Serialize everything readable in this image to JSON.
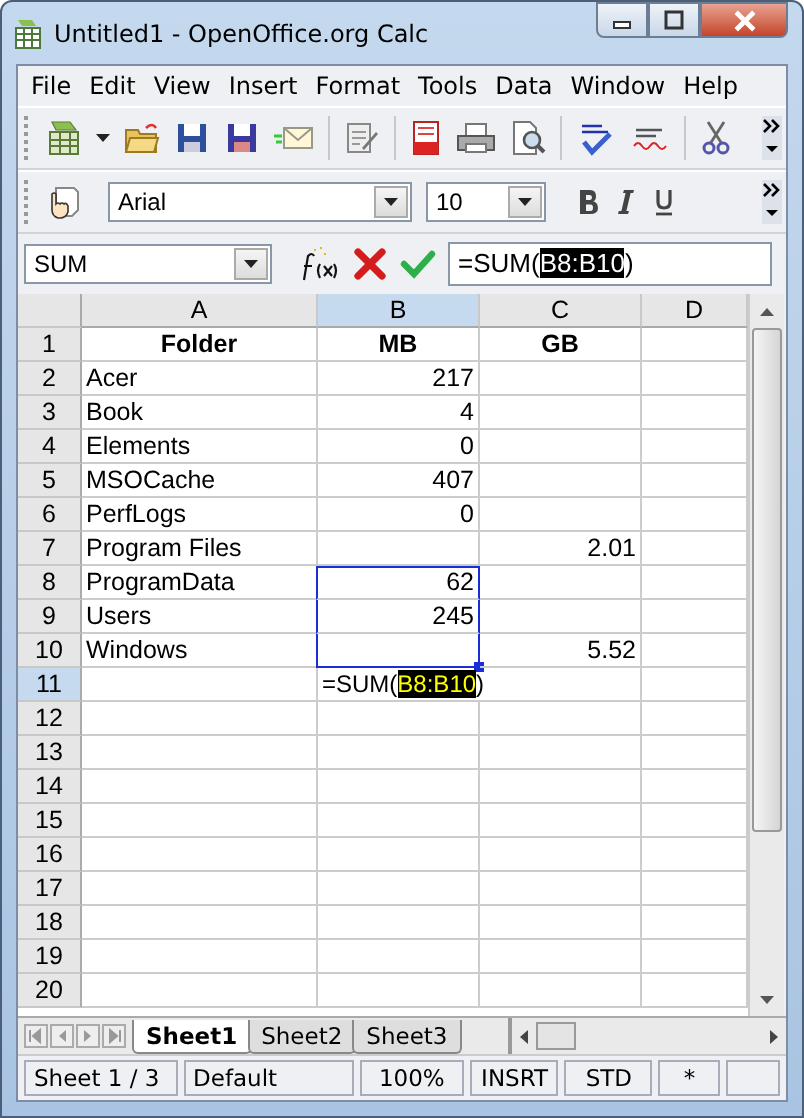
{
  "window": {
    "title": "Untitled1 - OpenOffice.org Calc"
  },
  "menu": [
    {
      "label": "File"
    },
    {
      "label": "Edit"
    },
    {
      "label": "View"
    },
    {
      "label": "Insert"
    },
    {
      "label": "Format"
    },
    {
      "label": "Tools"
    },
    {
      "label": "Data"
    },
    {
      "label": "Window"
    },
    {
      "label": "Help"
    }
  ],
  "formatting": {
    "font_name": "Arial",
    "font_size": "10"
  },
  "formula_bar": {
    "name_box": "SUM",
    "formula_prefix": "=SUM(",
    "formula_reference": "B8:B10",
    "formula_suffix": ")"
  },
  "columns": [
    {
      "label": "A",
      "selected": false
    },
    {
      "label": "B",
      "selected": true
    },
    {
      "label": "C",
      "selected": false
    },
    {
      "label": "D",
      "selected": false
    }
  ],
  "rows": [
    {
      "number": "1",
      "selected": false,
      "kind": "header",
      "a": "Folder",
      "b": "MB",
      "c": "GB"
    },
    {
      "number": "2",
      "selected": false,
      "kind": "data",
      "a": "Acer",
      "b": "217"
    },
    {
      "number": "3",
      "selected": false,
      "kind": "data",
      "a": "Book",
      "b": "4"
    },
    {
      "number": "4",
      "selected": false,
      "kind": "data",
      "a": "Elements",
      "b": "0"
    },
    {
      "number": "5",
      "selected": false,
      "kind": "data",
      "a": "MSOCache",
      "b": "407"
    },
    {
      "number": "6",
      "selected": false,
      "kind": "data",
      "a": "PerfLogs",
      "b": "0"
    },
    {
      "number": "7",
      "selected": false,
      "kind": "data",
      "a": "Program Files",
      "c": "2.01"
    },
    {
      "number": "8",
      "selected": false,
      "kind": "data",
      "a": "ProgramData",
      "b": "62",
      "in_range": true
    },
    {
      "number": "9",
      "selected": false,
      "kind": "data",
      "a": "Users",
      "b": "245",
      "in_range": true
    },
    {
      "number": "10",
      "selected": false,
      "kind": "data",
      "a": "Windows",
      "c": "5.52",
      "in_range": true
    },
    {
      "number": "11",
      "selected": true,
      "kind": "editing",
      "b_prefix": "=SUM(",
      "b_reference": "B8:B10",
      "b_suffix": ")"
    },
    {
      "number": "12",
      "selected": false,
      "kind": "data"
    },
    {
      "number": "13",
      "selected": false,
      "kind": "data"
    },
    {
      "number": "14",
      "selected": false,
      "kind": "data"
    },
    {
      "number": "15",
      "selected": false,
      "kind": "data"
    },
    {
      "number": "16",
      "selected": false,
      "kind": "data"
    },
    {
      "number": "17",
      "selected": false,
      "kind": "data"
    },
    {
      "number": "18",
      "selected": false,
      "kind": "data"
    },
    {
      "number": "19",
      "selected": false,
      "kind": "data"
    },
    {
      "number": "20",
      "selected": false,
      "kind": "data"
    }
  ],
  "sheet_tabs": [
    {
      "label": "Sheet1",
      "selected": true
    },
    {
      "label": "Sheet2",
      "selected": false
    },
    {
      "label": "Sheet3",
      "selected": false
    }
  ],
  "status_bar": [
    "Sheet 1 / 3",
    "Default",
    "100%",
    "INSRT",
    "STD",
    "*"
  ]
}
